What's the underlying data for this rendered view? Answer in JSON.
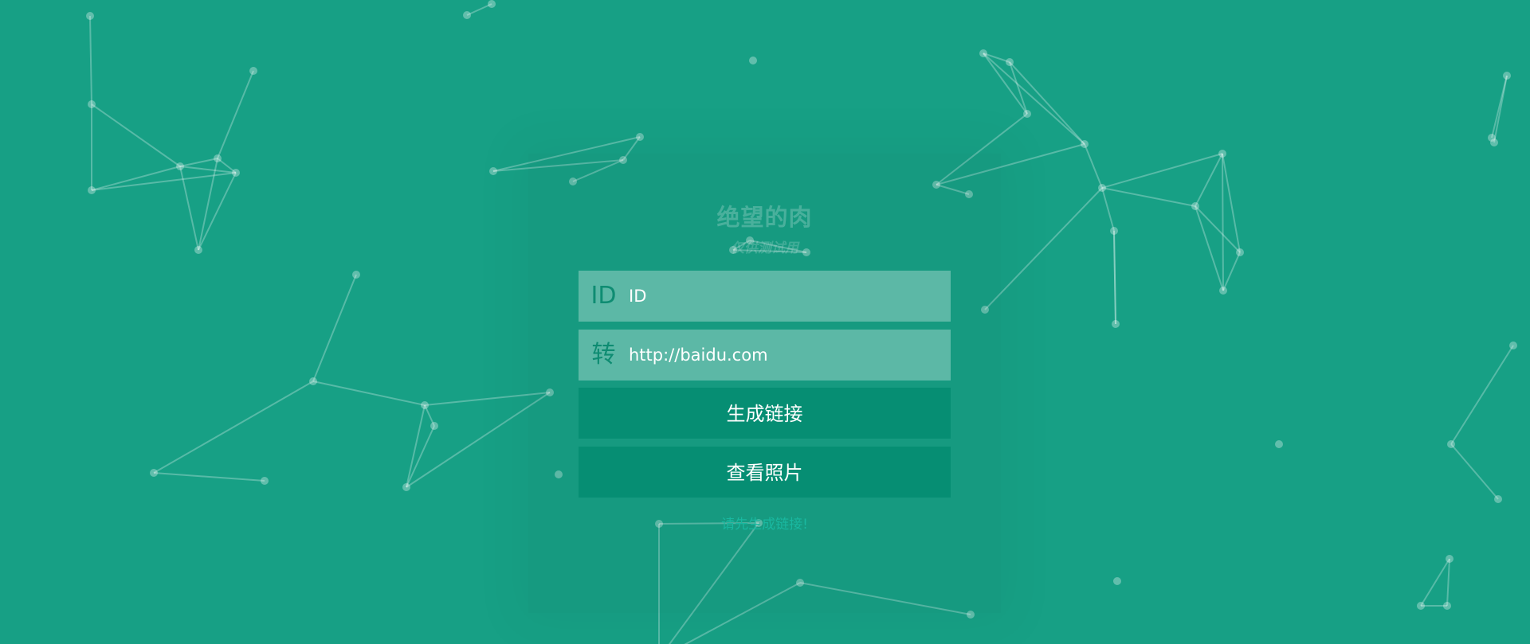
{
  "header": {
    "title": "绝望的肉",
    "subtitle": "仅供测试用"
  },
  "form": {
    "id_tag": "ID",
    "id_placeholder": "ID",
    "url_tag": "转",
    "url_value": "http://baidu.com"
  },
  "buttons": {
    "generate_label": "生成链接",
    "view_label": "查看照片"
  },
  "status": {
    "message": "请先生成链接!"
  },
  "colors": {
    "background": "#17a085",
    "button": "#068e73",
    "status_text": "#19b8a0"
  }
}
